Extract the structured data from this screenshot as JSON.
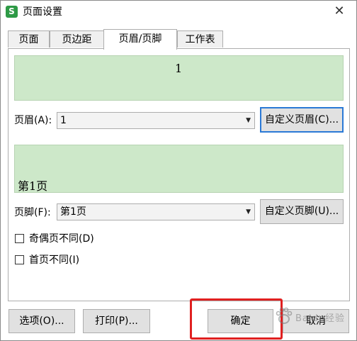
{
  "window": {
    "app_icon_glyph": "S",
    "title": "页面设置",
    "close_glyph": "✕"
  },
  "tabs": [
    {
      "label": "页面",
      "active": false
    },
    {
      "label": "页边距",
      "active": false
    },
    {
      "label": "页眉/页脚",
      "active": true
    },
    {
      "label": "工作表",
      "active": false
    }
  ],
  "header": {
    "preview_text": "1",
    "label": "页眉(A):",
    "value": "1",
    "custom_button": "自定义页眉(C)..."
  },
  "footer": {
    "preview_text": "第1页",
    "label": "页脚(F):",
    "value": "第1页",
    "custom_button": "自定义页脚(U)..."
  },
  "options": {
    "odd_even": {
      "label": "奇偶页不同(D)",
      "checked": false
    },
    "first_page": {
      "label": "首页不同(I)",
      "checked": false
    }
  },
  "buttons": {
    "options": "选项(O)...",
    "print": "打印(P)...",
    "ok": "确定",
    "cancel": "取消"
  },
  "watermark": {
    "text": "Baidu经验"
  },
  "colors": {
    "preview_bg": "#cde8c9",
    "highlight": "#e02020",
    "app_icon": "#2e9a46"
  }
}
